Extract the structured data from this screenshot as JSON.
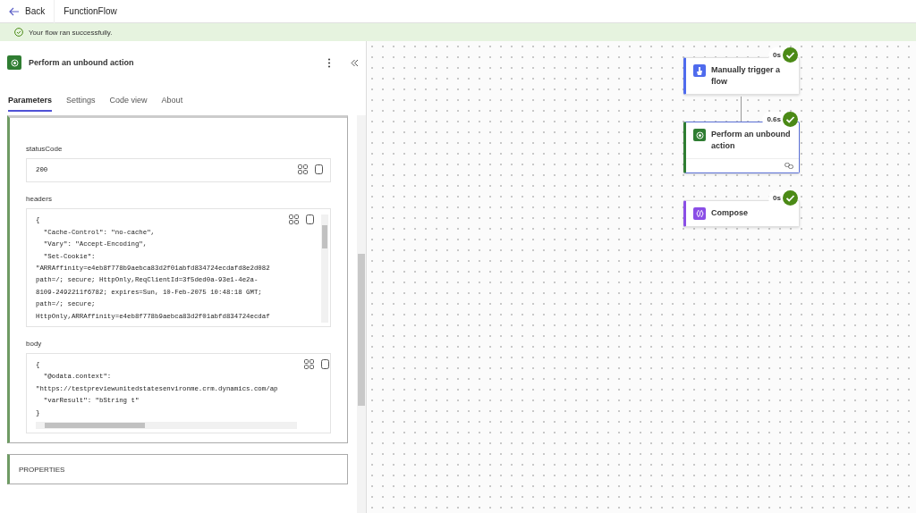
{
  "top_bar": {
    "back_label": "Back",
    "title": "FunctionFlow"
  },
  "banner": {
    "message": "Your flow ran successfully."
  },
  "panel": {
    "title": "Perform an unbound action",
    "tabs": [
      {
        "label": "Parameters",
        "selected": true
      },
      {
        "label": "Settings",
        "selected": false
      },
      {
        "label": "Code view",
        "selected": false
      },
      {
        "label": "About",
        "selected": false
      }
    ],
    "fields": [
      {
        "label": "statusCode",
        "kind": "single",
        "lines": [
          "200"
        ]
      },
      {
        "label": "headers",
        "kind": "code",
        "lines": [
          "{",
          "  \"Cache-Control\": \"no-cache\",",
          "  \"Vary\": \"Accept-Encoding\",",
          "  \"Set-Cookie\":",
          "\"ARRAffinity=e4eb8f778b9aebca83d2f01abfd834724ecdafd8e2d082",
          "path=/; secure; HttpOnly,ReqClientId=3f5ded0a-93e1-4e2a-",
          "8109-2492211f6782; expires=Sun, 10-Feb-2075 10:48:18 GMT;",
          "path=/; secure;",
          "HttpOnly,ARRAffinity=e4eb8f778b9aebca83d2f01abfd834724ecdaf"
        ]
      },
      {
        "label": "body",
        "kind": "code_hscroll",
        "lines": [
          "{",
          "  \"@odata.context\":",
          "\"https://testpreviewunitedstatesenvironme.crm.dynamics.com/ap",
          "  \"varResult\": \"bString t\"",
          "}"
        ]
      }
    ],
    "section": {
      "title": "PROPERTIES"
    }
  },
  "canvas": {
    "nodes": [
      {
        "kind": "trigger",
        "title": "Manually trigger a flow",
        "duration": "0s",
        "succeeded": true,
        "selected": false
      },
      {
        "kind": "action",
        "title": "Perform an unbound action",
        "duration": "0.6s",
        "succeeded": true,
        "selected": true
      },
      {
        "kind": "compose",
        "title": "Compose",
        "duration": "0s",
        "succeeded": true,
        "selected": false
      }
    ]
  }
}
